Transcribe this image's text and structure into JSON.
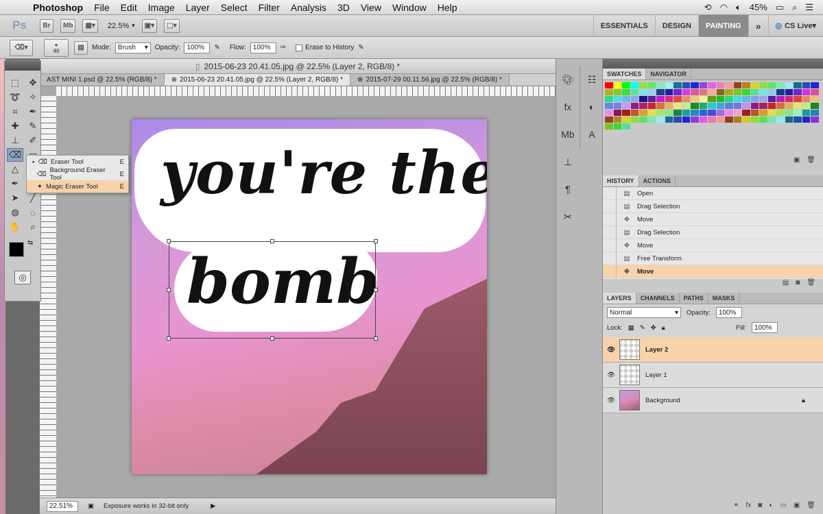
{
  "menubar": {
    "app_name": "Photoshop",
    "items": [
      "File",
      "Edit",
      "Image",
      "Layer",
      "Select",
      "Filter",
      "Analysis",
      "3D",
      "View",
      "Window",
      "Help"
    ],
    "battery": "45%"
  },
  "appbar": {
    "logo": "Ps",
    "bridge": "Br",
    "minibridge": "Mb",
    "zoom": "22.5%",
    "workspaces": [
      "ESSENTIALS",
      "DESIGN",
      "PAINTING"
    ],
    "active_workspace": "PAINTING",
    "more": "»",
    "cs_live": "CS Live"
  },
  "options": {
    "brush_size": "40",
    "mode_label": "Mode:",
    "mode_value": "Brush",
    "opacity_label": "Opacity:",
    "opacity_value": "100%",
    "flow_label": "Flow:",
    "flow_value": "100%",
    "erase_history": "Erase to History"
  },
  "flyout": {
    "items": [
      {
        "label": "Eraser Tool",
        "key": "E"
      },
      {
        "label": "Background Eraser Tool",
        "key": "E"
      },
      {
        "label": "Magic Eraser Tool",
        "key": "E"
      }
    ]
  },
  "document": {
    "title": "2015-06-23 20.41.05.jpg @ 22.5% (Layer 2, RGB/8) *",
    "tabs": [
      "AST MINI 1.psd @ 22.5% (RGB/8) *",
      "2015-06-23 20.41.05.jpg @ 22.5% (Layer 2, RGB/8) *",
      "2015-07-29 00.11.56.jpg @ 22.5% (RGB/8) *"
    ],
    "text_line1": "you're the",
    "text_line2": "bomb"
  },
  "status": {
    "zoom": "22.51%",
    "message": "Exposure works in 32-bit only"
  },
  "swatches": {
    "tabs": [
      "SWATCHES",
      "NAVIGATOR"
    ]
  },
  "history": {
    "tabs": [
      "HISTORY",
      "ACTIONS"
    ],
    "items": [
      "Open",
      "Drag Selection",
      "Move",
      "Drag Selection",
      "Move",
      "Free Transform",
      "Move"
    ],
    "selected_index": 6
  },
  "layers": {
    "tabs": [
      "LAYERS",
      "CHANNELS",
      "PATHS",
      "MASKS"
    ],
    "blend_mode": "Normal",
    "opacity_label": "Opacity:",
    "opacity_value": "100%",
    "lock_label": "Lock:",
    "fill_label": "Fill:",
    "fill_value": "100%",
    "items": [
      "Layer 2",
      "Layer 1",
      "Background"
    ],
    "selected_index": 0
  }
}
